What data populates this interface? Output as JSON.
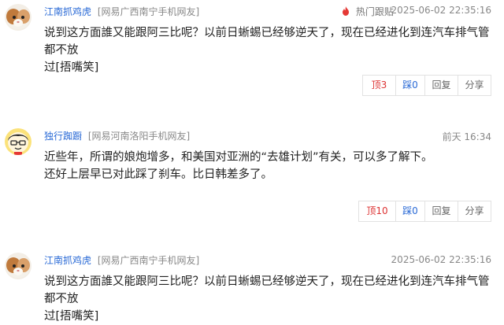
{
  "comments": [
    {
      "user": "江南抓鸡虎",
      "source": "[网易广西南宁手机网友]",
      "hot_label": "热门跟贴",
      "time": "2025-06-02 22:35:16",
      "lines": [
        "说到这方面誰又能跟阿三比呢？以前日蜥蜴已经够逆天了，现在已经进化到连汽车排气管都不放",
        "过[捂嘴笑]"
      ],
      "actions": {
        "up": "顶3",
        "down": "踩0",
        "reply": "回复",
        "share": "分享"
      }
    },
    {
      "user": "独行踟蹰",
      "source": "[网易河南洛阳手机网友]",
      "time": "前天 16:34",
      "lines": [
        "近些年，所谓的娘炮增多，和美国对亚洲的“去雄计划”有关，可以多了解下。",
        "还好上层早已对此踩了刹车。比日韩差多了。"
      ],
      "actions": {
        "up": "顶10",
        "down": "踩0",
        "reply": "回复",
        "share": "分享"
      }
    },
    {
      "user": "江南抓鸡虎",
      "source": "[网易广西南宁手机网友]",
      "time": "2025-06-02 22:35:16",
      "lines": [
        "说到这方面誰又能跟阿三比呢？以前日蜥蜴已经够逆天了，现在已经进化到连汽车排气管都不放",
        "过[捂嘴笑]"
      ]
    }
  ]
}
